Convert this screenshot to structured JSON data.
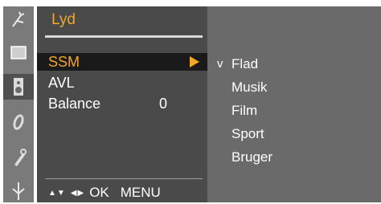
{
  "menu": {
    "title": "Lyd",
    "items": [
      {
        "label": "SSM",
        "value": "",
        "selected": true
      },
      {
        "label": "AVL",
        "value": "",
        "selected": false
      },
      {
        "label": "Balance",
        "value": "0",
        "selected": false
      }
    ],
    "help": {
      "updown": "▲▼",
      "leftright": "◀▶",
      "ok": "OK",
      "menu": "MENU"
    }
  },
  "submenu": {
    "check_mark": "v",
    "items": [
      "Flad",
      "Musik",
      "Film",
      "Sport",
      "Bruger"
    ],
    "selected_index": 0
  },
  "iconbar": {
    "icons": [
      "antenna-icon",
      "picture-icon",
      "speaker-icon",
      "clock-icon",
      "key-icon",
      "input-icon"
    ],
    "active_index": 2
  },
  "colors": {
    "accent": "#f5a623",
    "menu_bg": "#4a4a4a",
    "submenu_bg": "#6a6a6a",
    "iconbar_bg": "#7a7a7a"
  }
}
